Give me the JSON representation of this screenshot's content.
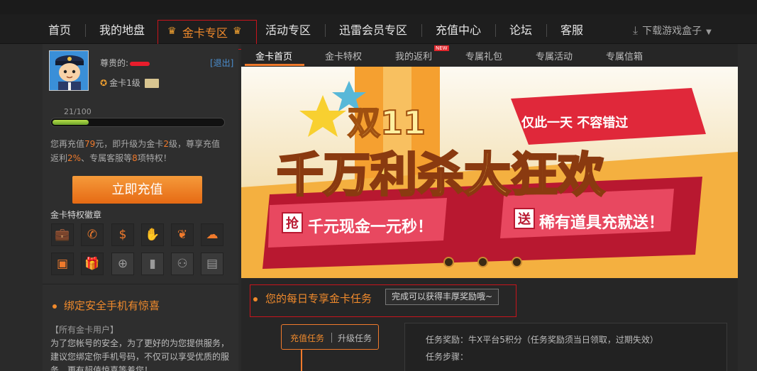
{
  "nav": {
    "items": [
      "首页",
      "我的地盘",
      "金卡专区",
      "活动专区",
      "迅雷会员专区",
      "充值中心",
      "论坛",
      "客服"
    ],
    "download_label": "下载游戏盒子"
  },
  "sidebar": {
    "greeting": "尊贵的:",
    "logout": "[退出]",
    "level": "金卡1级",
    "progress_text": "21/100",
    "progress_fraction": 0.21,
    "upgrade_line1_a": "您再充值",
    "upgrade_line1_b": "79",
    "upgrade_line1_c": "元，即升级为金卡",
    "upgrade_line1_d": "2",
    "upgrade_line1_e": "级，尊享充值",
    "upgrade_line2_a": "返利",
    "upgrade_line2_b": "2%",
    "upgrade_line2_c": "、专属客服等",
    "upgrade_line2_d": "8",
    "upgrade_line2_e": "项特权！",
    "recharge_button": "立即充值",
    "badges_title": "金卡特权徽章",
    "badges": [
      {
        "icon": "briefcase-icon",
        "lit": true
      },
      {
        "icon": "phone-icon",
        "lit": true
      },
      {
        "icon": "money-bag-icon",
        "lit": true
      },
      {
        "icon": "hands-gift-icon",
        "lit": true
      },
      {
        "icon": "leaf-icon",
        "lit": true
      },
      {
        "icon": "chat-icon",
        "lit": true
      },
      {
        "icon": "monitor-icon",
        "lit": true
      },
      {
        "icon": "gift-icon",
        "lit": true
      },
      {
        "icon": "add-user-icon",
        "lit": false
      },
      {
        "icon": "book-icon",
        "lit": false
      },
      {
        "icon": "users-icon",
        "lit": false
      },
      {
        "icon": "ticket-icon",
        "lit": false
      }
    ],
    "bind_title": "绑定安全手机有惊喜",
    "bind_subtitle": "【所有金卡用户】",
    "bind_body": "为了您帐号的安全，为了更好的为您提供服务，建议您绑定你手机号码，不仅可以享受优质的服务，更有超值惊喜等着您！"
  },
  "main": {
    "tabs": [
      "金卡首页",
      "金卡特权",
      "我的返利",
      "专属礼包",
      "专属活动",
      "专属信箱"
    ],
    "new_tag": "NEW",
    "banner": {
      "line1": "双11",
      "line2": "千万利杀大狂欢",
      "ribbon": "仅此一天 不容错过",
      "left_tag": "抢",
      "left_text": "千元现金一元秒！",
      "right_tag": "送",
      "right_text": "稀有道具充就送！"
    },
    "task_title": "您的每日专享金卡任务",
    "task_tip": "完成可以获得丰厚奖励哦~",
    "task_tab_recharge": "充值任务",
    "task_tab_upgrade": "升级任务",
    "task_reward": "任务奖励：牛X平台5积分（任务奖励须当日领取，过期失效）",
    "task_steps": "任务步骤："
  },
  "colors": {
    "accent": "#f07a2c",
    "highlight_border": "#c8141c",
    "background": "#2a2a2a"
  }
}
